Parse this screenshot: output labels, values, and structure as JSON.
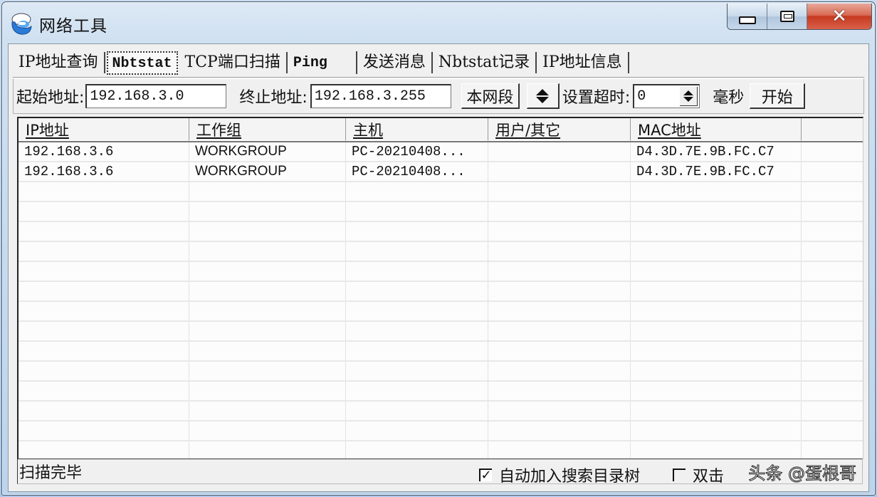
{
  "window": {
    "title": "网络工具",
    "app_icon": "smurf-logo-icon",
    "buttons": {
      "minimize": "minimize-icon",
      "maximize": "maximize-icon",
      "close": "close-icon",
      "close_glyph": "✕"
    }
  },
  "tabs": [
    {
      "label": "IP地址查询",
      "active": false
    },
    {
      "label": "Nbtstat",
      "active": true
    },
    {
      "label": "TCP端口扫描",
      "active": false
    },
    {
      "label": "Ping",
      "active": false
    },
    {
      "label": "发送消息",
      "active": false
    },
    {
      "label": "Nbtstat记录",
      "active": false
    },
    {
      "label": "IP地址信息",
      "active": false
    }
  ],
  "toolbar": {
    "start_label": "起始地址:",
    "start_value": "192.168.3.0",
    "end_label": "终止地址:",
    "end_value": "192.168.3.255",
    "local_segment_button": "本网段",
    "timeout_label": "设置超时:",
    "timeout_value": "0",
    "timeout_unit": "毫秒",
    "start_button": "开始"
  },
  "table": {
    "columns": [
      "IP地址",
      "工作组",
      "主机",
      "用户/其它",
      "MAC地址",
      ""
    ],
    "rows": [
      [
        "192.168.3.6",
        "WORKGROUP",
        "PC-20210408...",
        "",
        "D4.3D.7E.9B.FC.C7",
        ""
      ],
      [
        "192.168.3.6",
        "WORKGROUP",
        "PC-20210408...",
        "",
        "D4.3D.7E.9B.FC.C7",
        ""
      ]
    ],
    "empty_row_count": 15
  },
  "status": {
    "text": "扫描完毕",
    "auto_add_checkbox": {
      "label": "自动加入搜索目录树",
      "checked": true,
      "mark": "✓"
    },
    "double_click_checkbox": {
      "label": "双击",
      "checked": false
    },
    "watermark": "头条 @蛋根哥"
  }
}
